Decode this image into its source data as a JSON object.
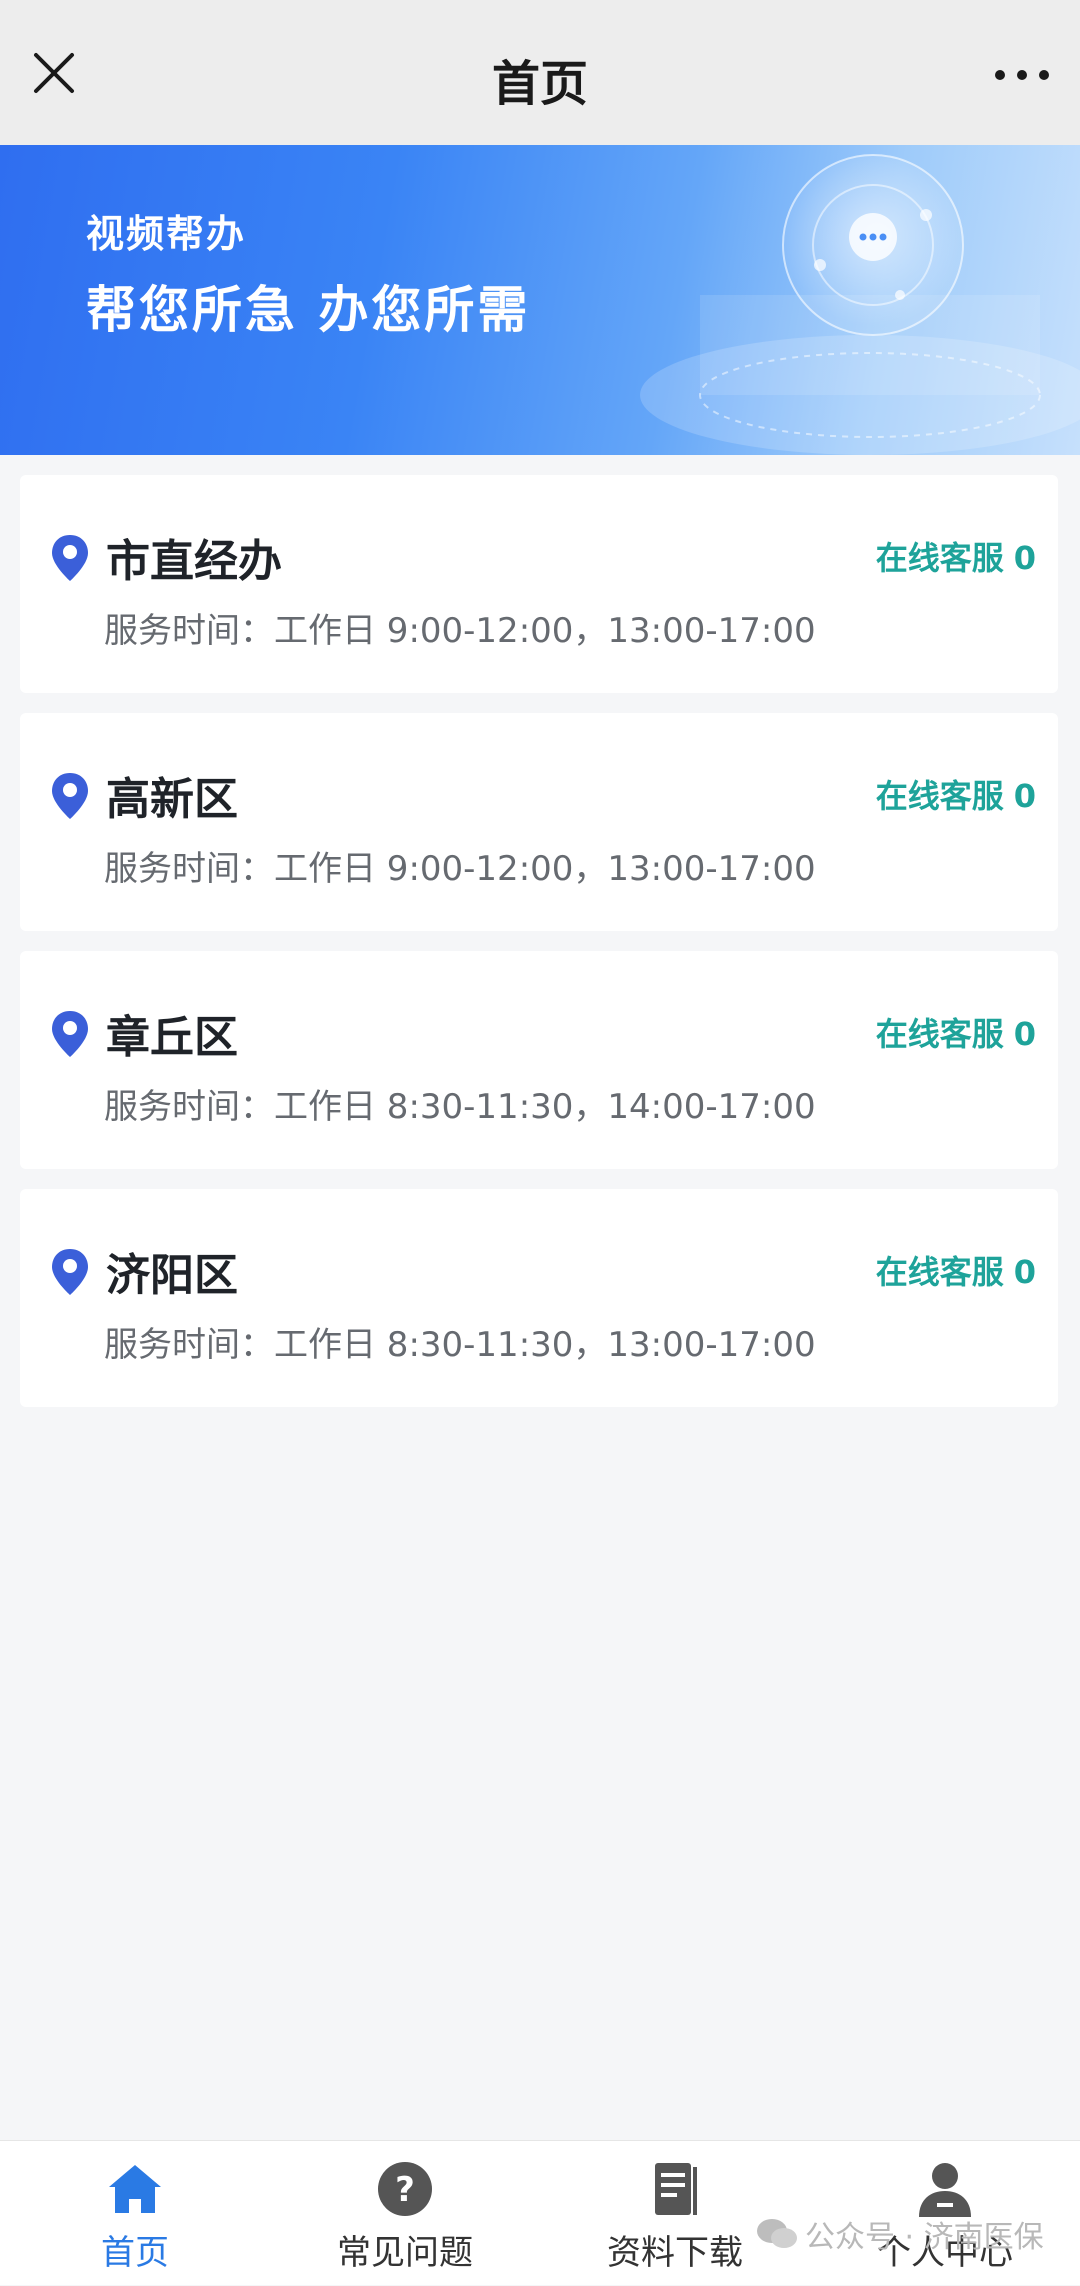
{
  "header": {
    "title": "首页"
  },
  "banner": {
    "subtitle": "视频帮办",
    "slogan": "帮您所急 办您所需"
  },
  "offices": [
    {
      "name": "市直经办",
      "online_label": "在线客服",
      "online_count": "0",
      "hours": "服务时间：工作日 9:00-12:00，13:00-17:00"
    },
    {
      "name": "高新区",
      "online_label": "在线客服",
      "online_count": "0",
      "hours": "服务时间：工作日 9:00-12:00，13:00-17:00"
    },
    {
      "name": "章丘区",
      "online_label": "在线客服",
      "online_count": "0",
      "hours": "服务时间：工作日 8:30-11:30，14:00-17:00"
    },
    {
      "name": "济阳区",
      "online_label": "在线客服",
      "online_count": "0",
      "hours": "服务时间：工作日 8:30-11:30，13:00-17:00"
    }
  ],
  "tabs": [
    {
      "label": "首页",
      "icon": "home-icon",
      "active": true
    },
    {
      "label": "常见问题",
      "icon": "question-icon",
      "active": false
    },
    {
      "label": "资料下载",
      "icon": "document-icon",
      "active": false
    },
    {
      "label": "个人中心",
      "icon": "user-icon",
      "active": false
    }
  ],
  "watermark": {
    "text": "公众号 · 济南医保"
  },
  "colors": {
    "accent": "#2a7ae4",
    "online": "#1ea39a",
    "pin": "#3b5fd9",
    "banner": "#3a84f5"
  }
}
